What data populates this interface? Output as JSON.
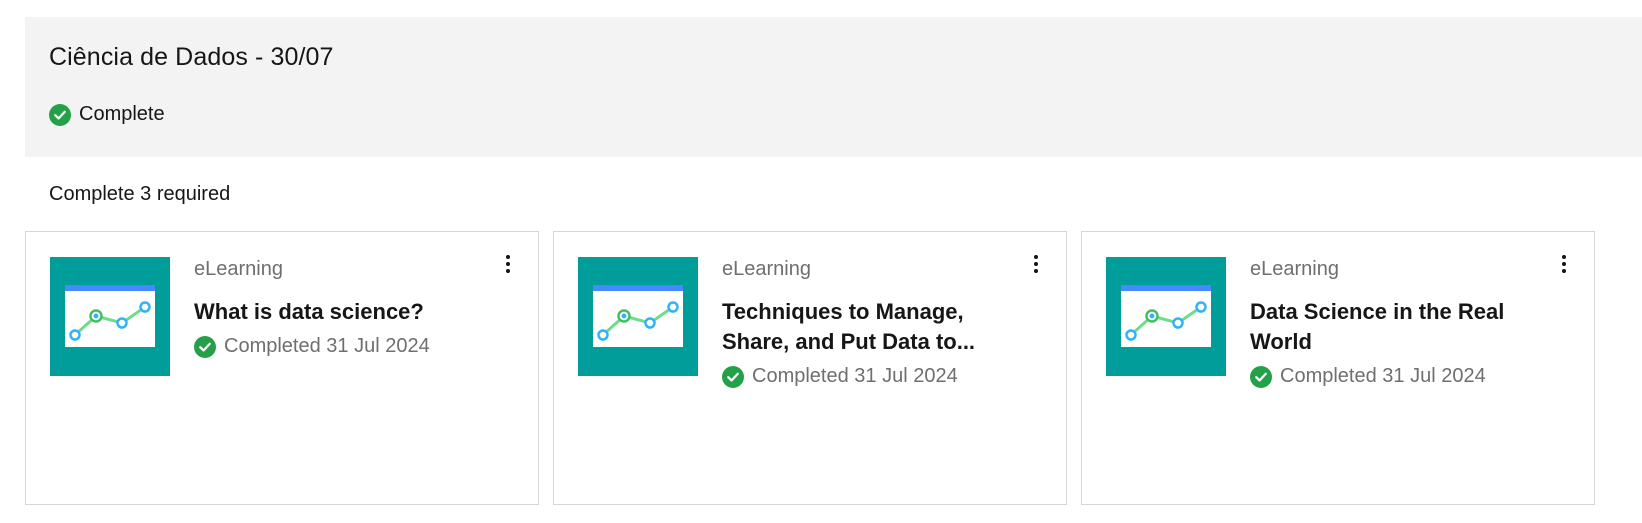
{
  "header": {
    "title": "Ciência de Dados - 30/07",
    "status": "Complete"
  },
  "requirement": {
    "label": "Complete 3 required"
  },
  "cards": [
    {
      "type": "eLearning",
      "title": "What is data science?",
      "status": "Completed 31 Jul 2024"
    },
    {
      "type": "eLearning",
      "title": "Techniques to Manage, Share, and Put Data to...",
      "status": "Completed 31 Jul 2024"
    },
    {
      "type": "eLearning",
      "title": "Data Science in the Real World",
      "status": "Completed 31 Jul 2024"
    }
  ],
  "icons": {
    "status": "check-circle-icon",
    "menu": "overflow-menu-vertical-icon",
    "thumbnail": "line-chart-thumbnail"
  },
  "colors": {
    "success_green": "#24a148",
    "thumbnail_teal": "#009d9a",
    "header_bg": "#f3f3f3"
  }
}
